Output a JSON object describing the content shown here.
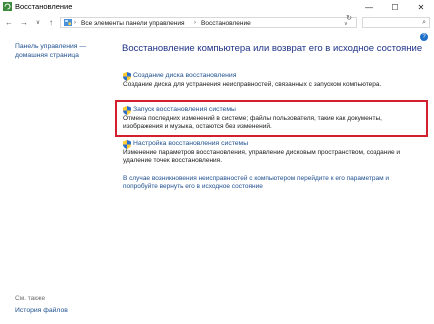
{
  "window": {
    "title": "Восстановление"
  },
  "address": {
    "crumbs": [
      "Все элементы панели управления",
      "Восстановление"
    ],
    "search_placeholder": "Поиск в панели управления"
  },
  "sidebar": {
    "home_link": "Панель управления — домашняя страница",
    "see_also_label": "См. также",
    "file_history": "История файлов"
  },
  "main": {
    "title": "Восстановление компьютера или возврат его в исходное состояние",
    "items": [
      {
        "label": "Создание диска восстановления",
        "desc": "Создание диска для устранения неисправностей, связанных с запуском компьютера."
      },
      {
        "label": "Запуск восстановления системы",
        "desc": "Отмена последних изменений в системе; файлы пользователя, такие как документы, изображения и музыка, остаются без изменений."
      },
      {
        "label": "Настройка восстановления системы",
        "desc": "Изменение параметров восстановления, управление дисковым пространством, создание и удаление точек восстановления."
      }
    ],
    "troubleshoot": "В случае возникновения неисправностей с компьютером перейдите к его параметрам и попробуйте вернуть его в исходное состояние"
  },
  "colors": {
    "link": "#1e4f8f",
    "title": "#1e3287",
    "highlight": "#d4202e"
  }
}
